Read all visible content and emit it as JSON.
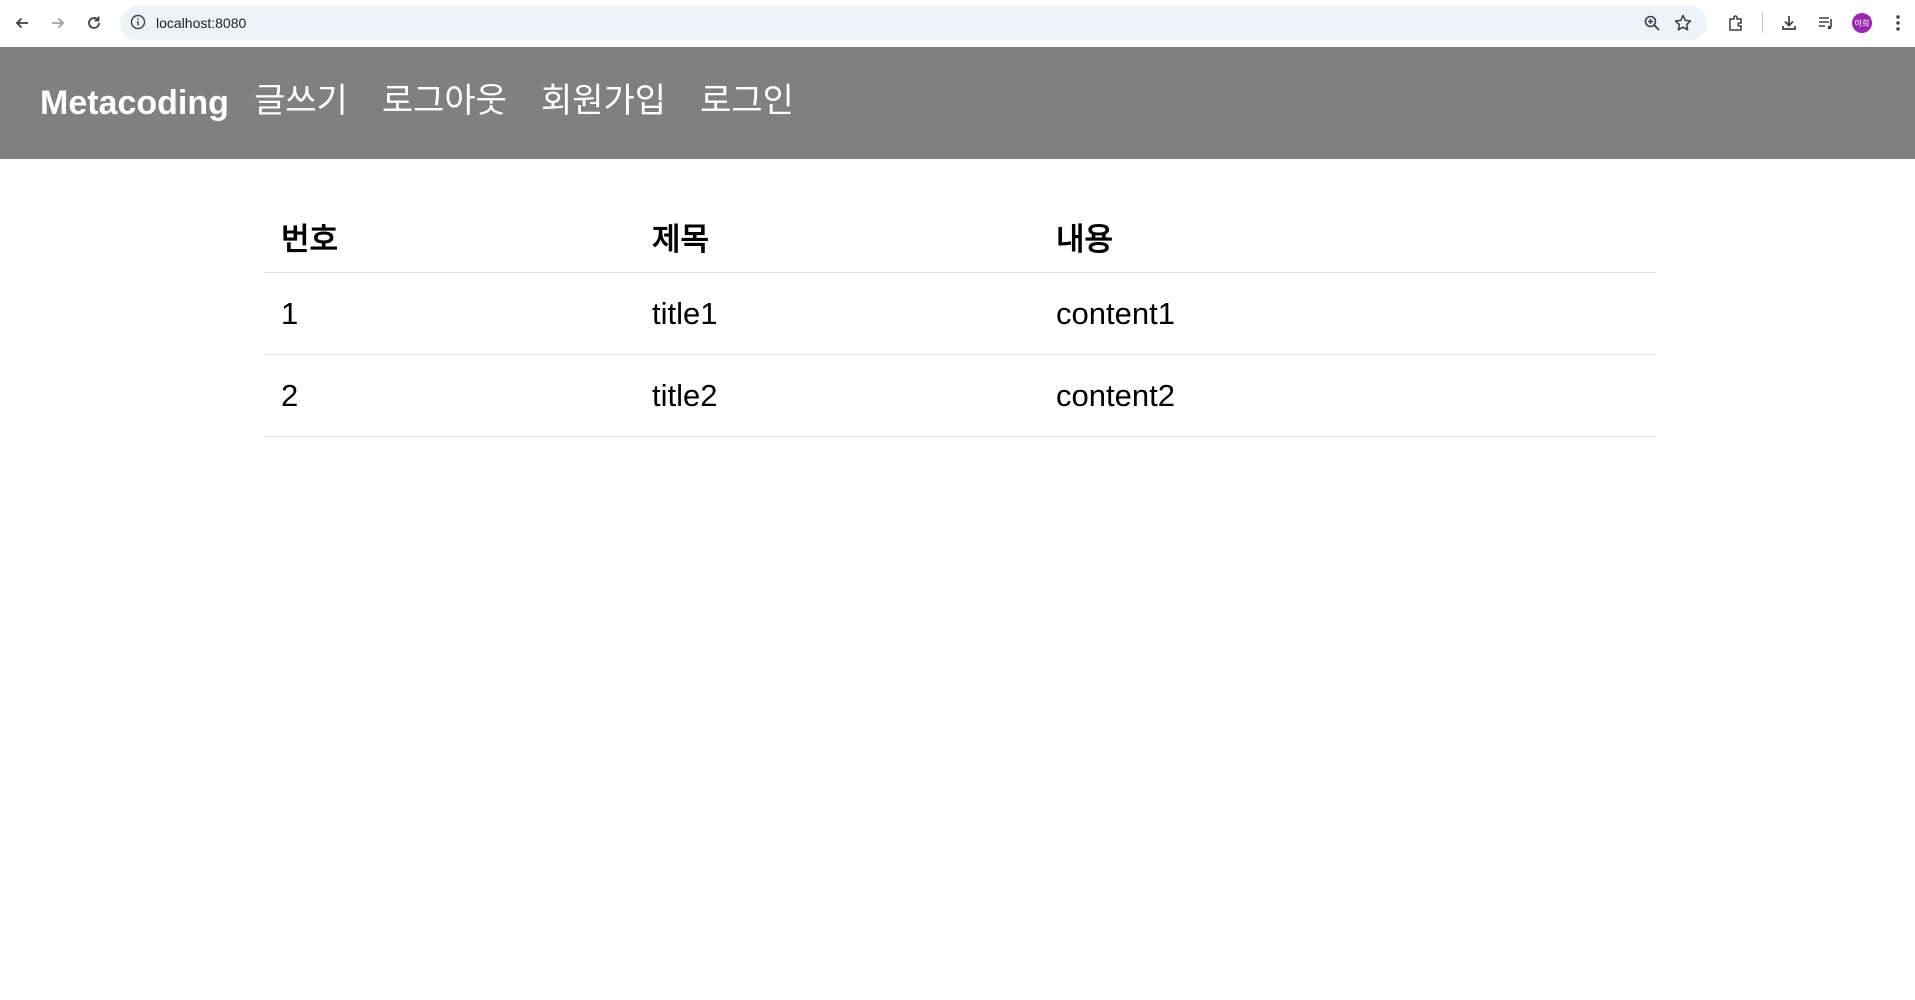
{
  "browser": {
    "url": "localhost:8080",
    "profile_initials": "아희",
    "colors": {
      "omnibox_bg": "#eef2f9",
      "avatar_bg": "#9c27b0"
    }
  },
  "navbar": {
    "brand": "Metacoding",
    "links": [
      "글쓰기",
      "로그아웃",
      "회원가입",
      "로그인"
    ],
    "colors": {
      "background": "#808080",
      "text": "#ffffff"
    }
  },
  "table": {
    "headers": [
      "번호",
      "제목",
      "내용"
    ],
    "rows": [
      [
        "1",
        "title1",
        "content1"
      ],
      [
        "2",
        "title2",
        "content2"
      ]
    ]
  }
}
